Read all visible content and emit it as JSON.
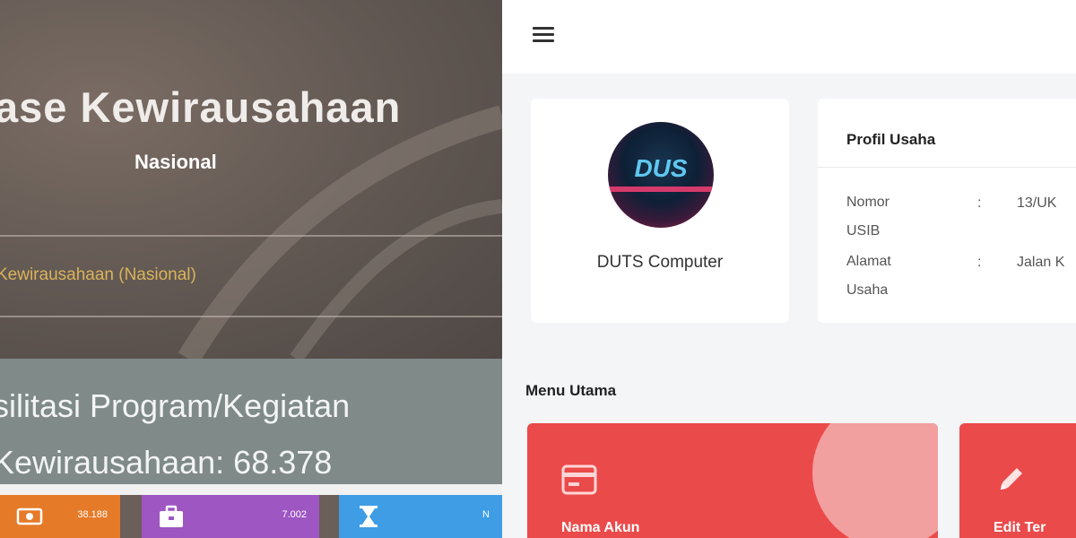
{
  "background": {
    "title": "ase Kewirausahaan",
    "subtitle": "Nasional",
    "link_text": "Kewirausahaan (Nasional)",
    "facilitation_line1": "silitasi Program/Kegiatan",
    "facilitation_line2": "Kewirausahaan: 68.378",
    "stat_cards": [
      {
        "icon": "money-icon",
        "value": "38.188",
        "color": "#e57a28"
      },
      {
        "icon": "briefcase-icon",
        "value": "7.002",
        "color": "#9d56c2"
      },
      {
        "icon": "hourglass-icon",
        "value": "N",
        "color": "#3f9de6"
      }
    ]
  },
  "app": {
    "profile": {
      "logo_text": "DUS",
      "name": "DUTS Computer"
    },
    "usaha": {
      "title": "Profil Usaha",
      "rows": [
        {
          "label_line1": "Nomor",
          "label_line2": "USIB",
          "colon": ":",
          "value": "13/UK"
        },
        {
          "label_line1": "Alamat",
          "label_line2": "Usaha",
          "colon": ":",
          "value": "Jalan K"
        }
      ]
    },
    "menu": {
      "title": "Menu Utama",
      "items": [
        {
          "label": "Nama Akun",
          "icon": "card-icon"
        },
        {
          "label": "Edit Ter",
          "icon": "pencil-icon"
        }
      ]
    }
  },
  "colors": {
    "accent_red": "#eb4a4a",
    "link_gold": "#d9b35a"
  }
}
